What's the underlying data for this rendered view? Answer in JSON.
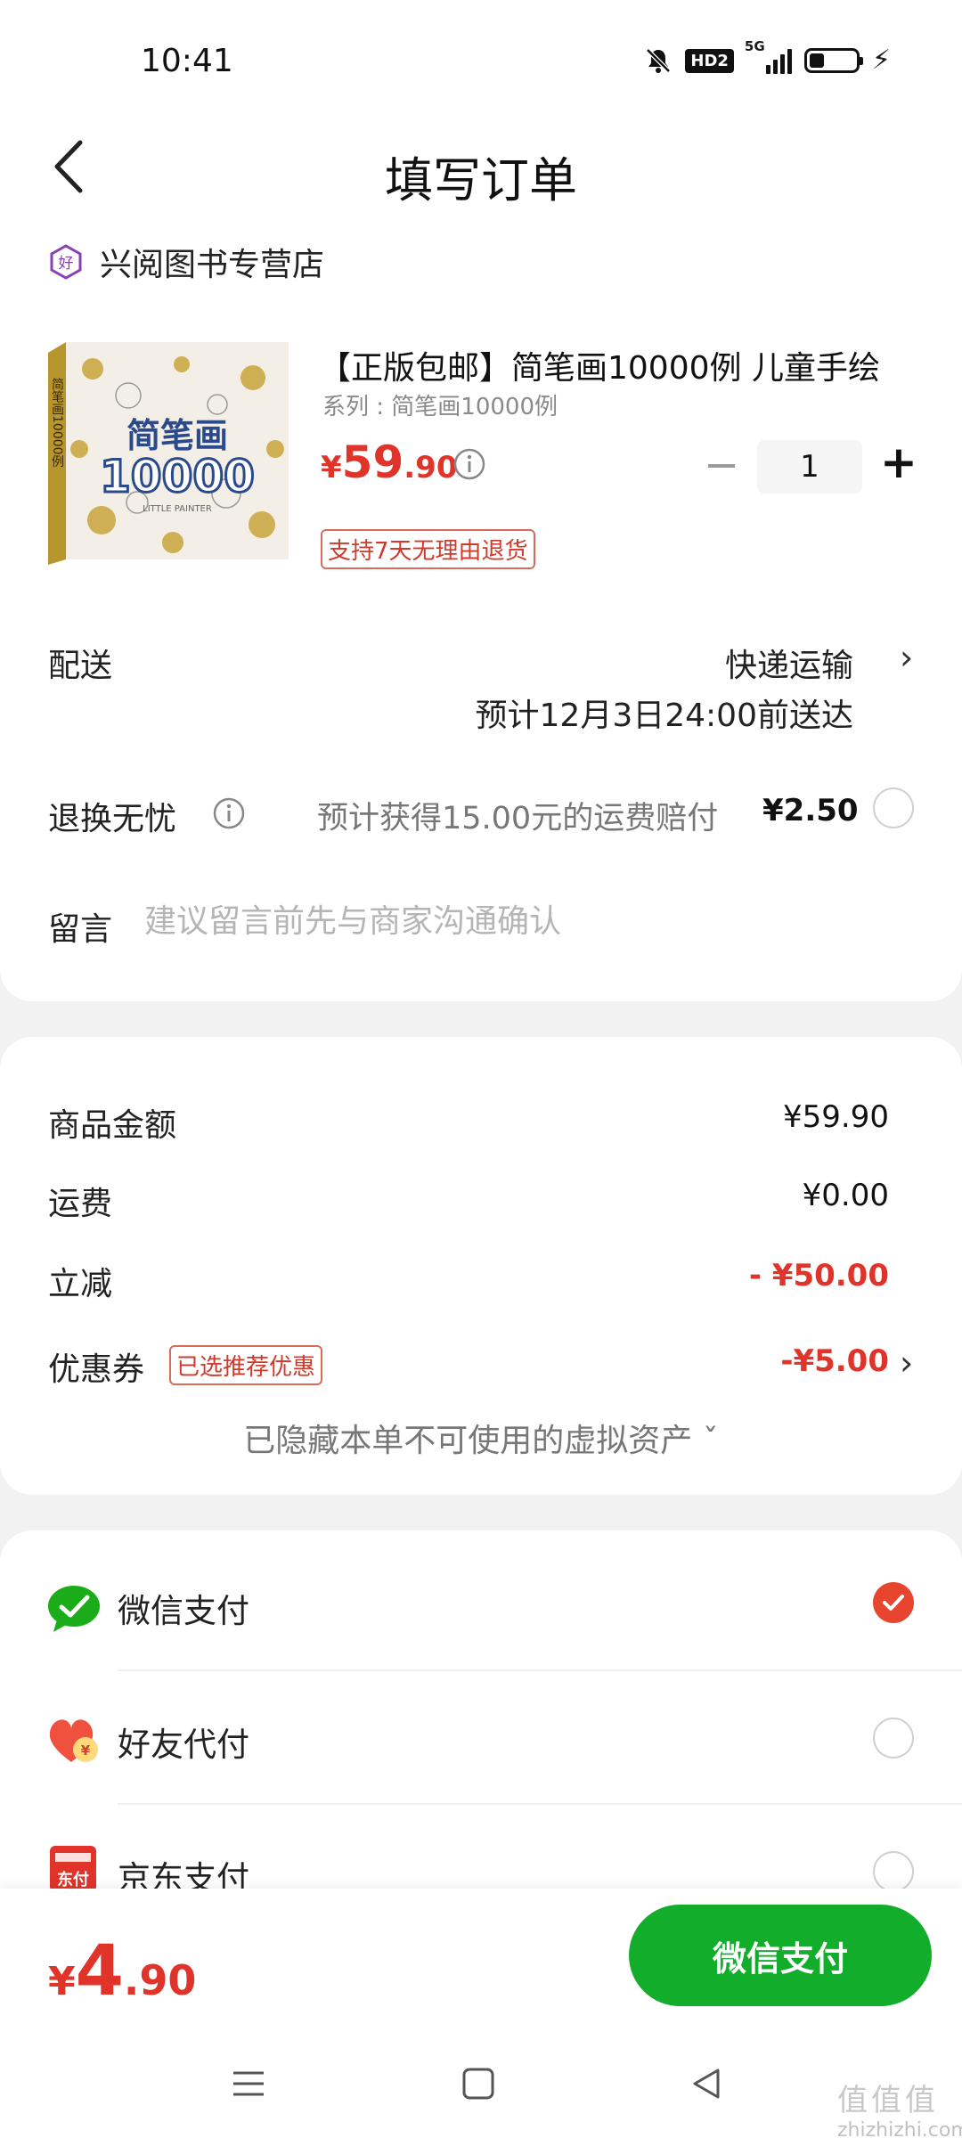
{
  "status_bar": {
    "time": "10:41",
    "network": "5G",
    "hd": "HD2"
  },
  "header": {
    "title": "填写订单"
  },
  "shop": {
    "badge_text": "好",
    "name": "兴阅图书专营店"
  },
  "product": {
    "title": "【正版包邮】简笔画10000例 儿童手绘",
    "series": "系列 : 简笔画10000例",
    "price_currency": "¥",
    "price_int": "59",
    "price_dec": ".90",
    "quantity": "1",
    "return_policy": "支持7天无理由退货",
    "cover_title": "简笔画",
    "cover_number": "10000",
    "cover_spine": "简笔画10000例",
    "cover_subtitle": "LITTLE PAINTER"
  },
  "delivery": {
    "label": "配送",
    "method": "快递运输",
    "eta": "预计12月3日24:00前送达"
  },
  "exchange": {
    "label": "退换无忧",
    "desc": "预计获得15.00元的运费赔付",
    "price": "¥2.50"
  },
  "message": {
    "label": "留言",
    "placeholder": "建议留言前先与商家沟通确认"
  },
  "summary": {
    "goods_label": "商品金额",
    "goods_value": "¥59.90",
    "shipping_label": "运费",
    "shipping_value": "¥0.00",
    "discount_label": "立减",
    "discount_value": "- ¥50.00",
    "coupon_label": "优惠券",
    "coupon_badge": "已选推荐优惠",
    "coupon_value": "-¥5.00",
    "hidden_assets": "已隐藏本单不可使用的虚拟资产 ˇ"
  },
  "payment_methods": [
    {
      "label": "微信支付",
      "selected": true
    },
    {
      "label": "好友代付",
      "selected": false,
      "icon_text": "¥"
    },
    {
      "label": "京东支付",
      "selected": false,
      "icon_text": "东付"
    }
  ],
  "footer": {
    "total_currency": "¥",
    "total_int": "4",
    "total_dec": ".90",
    "pay_button": "微信支付"
  },
  "watermark": {
    "line1": "值值值",
    "line2": "zhizhizhi.com"
  },
  "colors": {
    "accent_red": "#e0332a",
    "wechat_green": "#12ad2b",
    "radio_checked": "#e8452f"
  }
}
